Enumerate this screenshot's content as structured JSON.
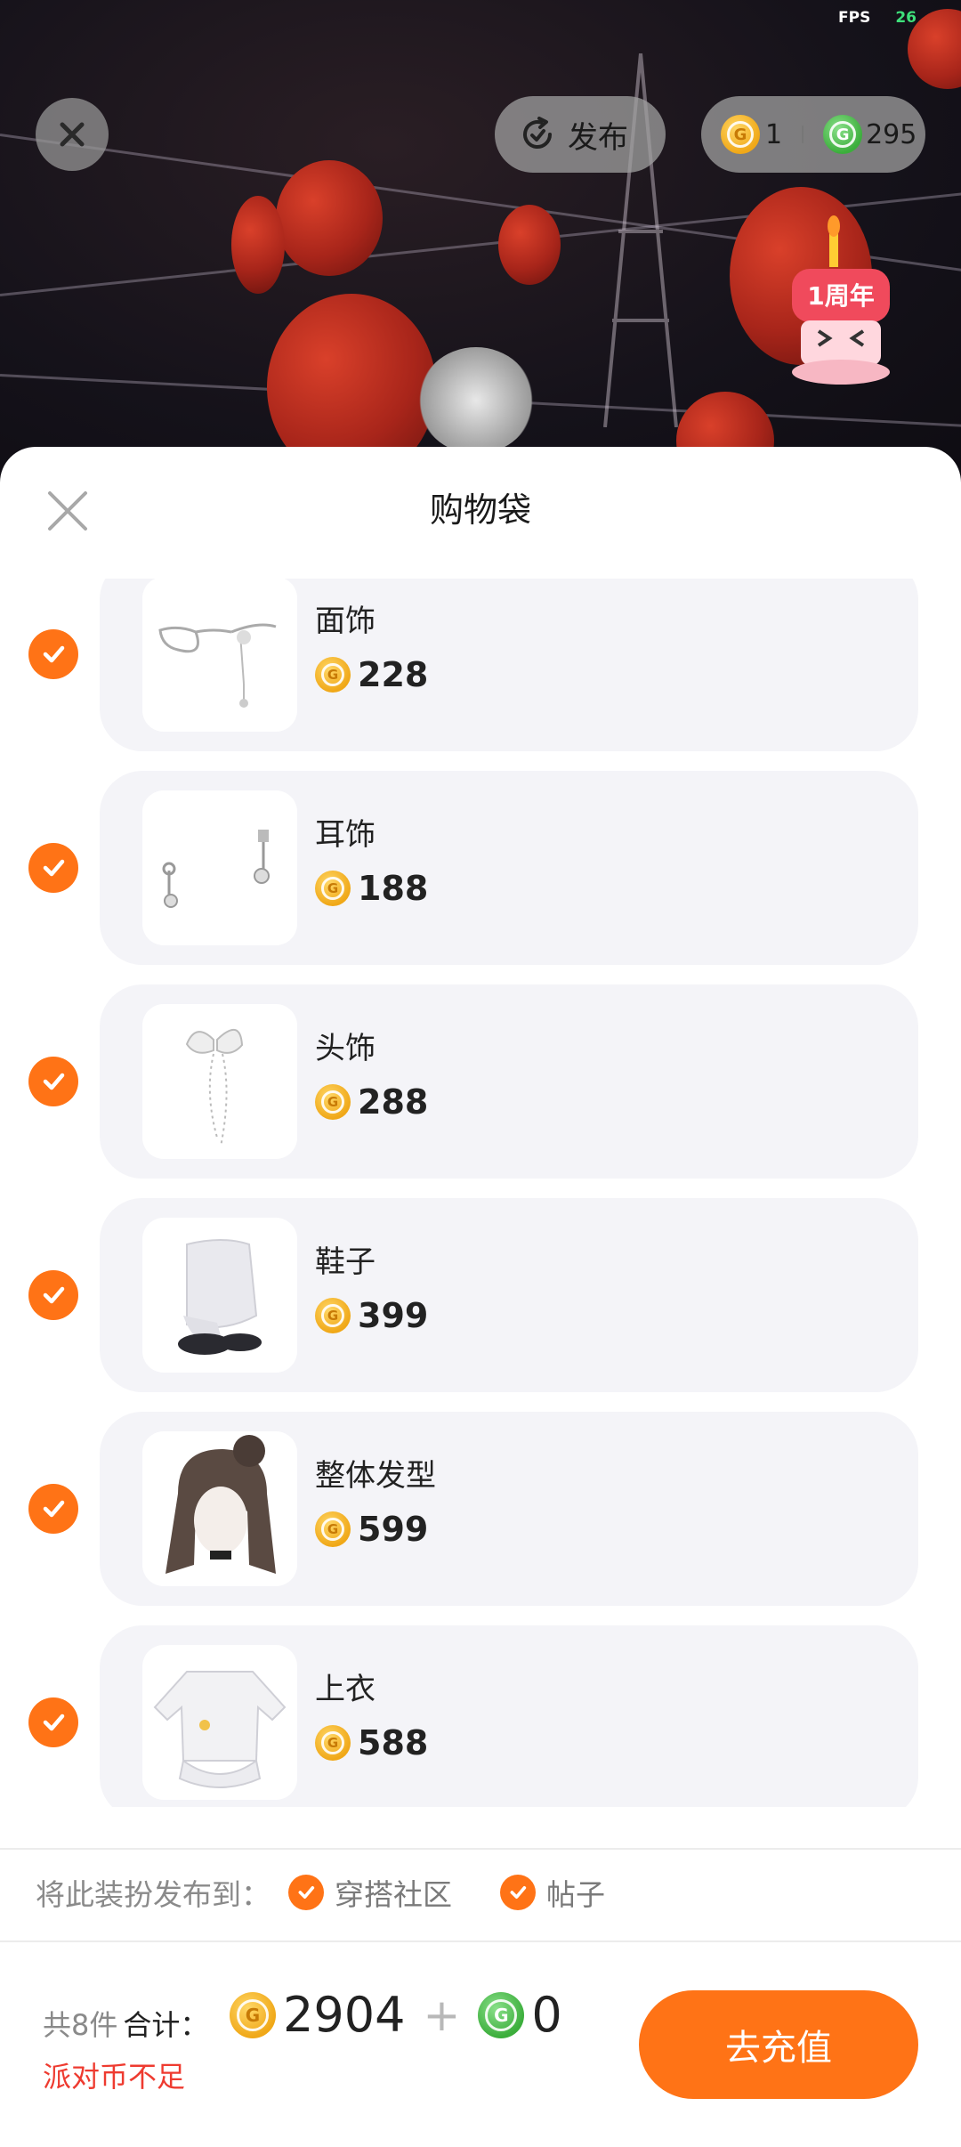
{
  "status": {
    "fps_label": "FPS",
    "fps_value": "26"
  },
  "topbar": {
    "publish_label": "发布",
    "gold_balance": "1",
    "green_balance": "295",
    "coin_glyph": "G"
  },
  "badge": {
    "text": "1周年"
  },
  "sheet": {
    "title": "购物袋"
  },
  "items": [
    {
      "name": "面饰",
      "price": "228",
      "checked": true
    },
    {
      "name": "耳饰",
      "price": "188",
      "checked": true
    },
    {
      "name": "头饰",
      "price": "288",
      "checked": true
    },
    {
      "name": "鞋子",
      "price": "399",
      "checked": true
    },
    {
      "name": "整体发型",
      "price": "599",
      "checked": true
    },
    {
      "name": "上衣",
      "price": "588",
      "checked": true
    }
  ],
  "publish": {
    "label": "将此装扮发布到：",
    "options": [
      {
        "label": "穿搭社区",
        "checked": true
      },
      {
        "label": "帖子",
        "checked": true
      }
    ]
  },
  "footer": {
    "count_text": "共8件",
    "total_label": "合计：",
    "gold_total": "2904",
    "plus": "+",
    "green_total": "0",
    "warning": "派对币不足",
    "recharge_label": "去充值"
  },
  "colors": {
    "accent": "#ff7316",
    "warning": "#ee3b30",
    "card_bg": "#f4f4f8",
    "fps_green": "#3ee07a"
  }
}
